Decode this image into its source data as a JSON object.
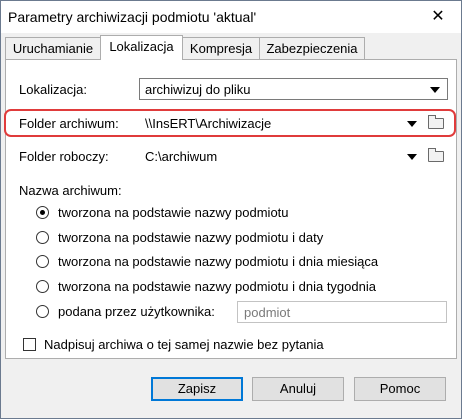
{
  "window": {
    "title": "Parametry archiwizacji podmiotu 'aktual'",
    "close_label": "✕"
  },
  "tabs": [
    {
      "label": "Uruchamianie"
    },
    {
      "label": "Lokalizacja",
      "active": true
    },
    {
      "label": "Kompresja"
    },
    {
      "label": "Zabezpieczenia"
    }
  ],
  "form": {
    "lokalizacja_label": "Lokalizacja:",
    "lokalizacja_value": "archiwizuj do pliku",
    "folder_archiwum_label": "Folder archiwum:",
    "folder_archiwum_value": "\\\\InsERT\\Archiwizacje",
    "folder_roboczy_label": "Folder roboczy:",
    "folder_roboczy_value": "C:\\archiwum",
    "nazwa_archiwum_label": "Nazwa archiwum:"
  },
  "radios": [
    {
      "label": "tworzona na podstawie nazwy podmiotu",
      "selected": true
    },
    {
      "label": "tworzona na podstawie nazwy podmiotu i daty",
      "selected": false
    },
    {
      "label": "tworzona na podstawie nazwy podmiotu i dnia miesiąca",
      "selected": false
    },
    {
      "label": "tworzona na podstawie nazwy podmiotu i dnia tygodnia",
      "selected": false
    },
    {
      "label": "podana przez użytkownika:",
      "selected": false
    }
  ],
  "user_name_placeholder": "podmiot",
  "checkbox": {
    "label": "Nadpisuj archiwa o tej samej nazwie bez pytania",
    "checked": false
  },
  "buttons": {
    "save": "Zapisz",
    "cancel": "Anuluj",
    "help": "Pomoc"
  },
  "colors": {
    "highlight": "#e03b3b",
    "default_button_border": "#0078d7"
  }
}
